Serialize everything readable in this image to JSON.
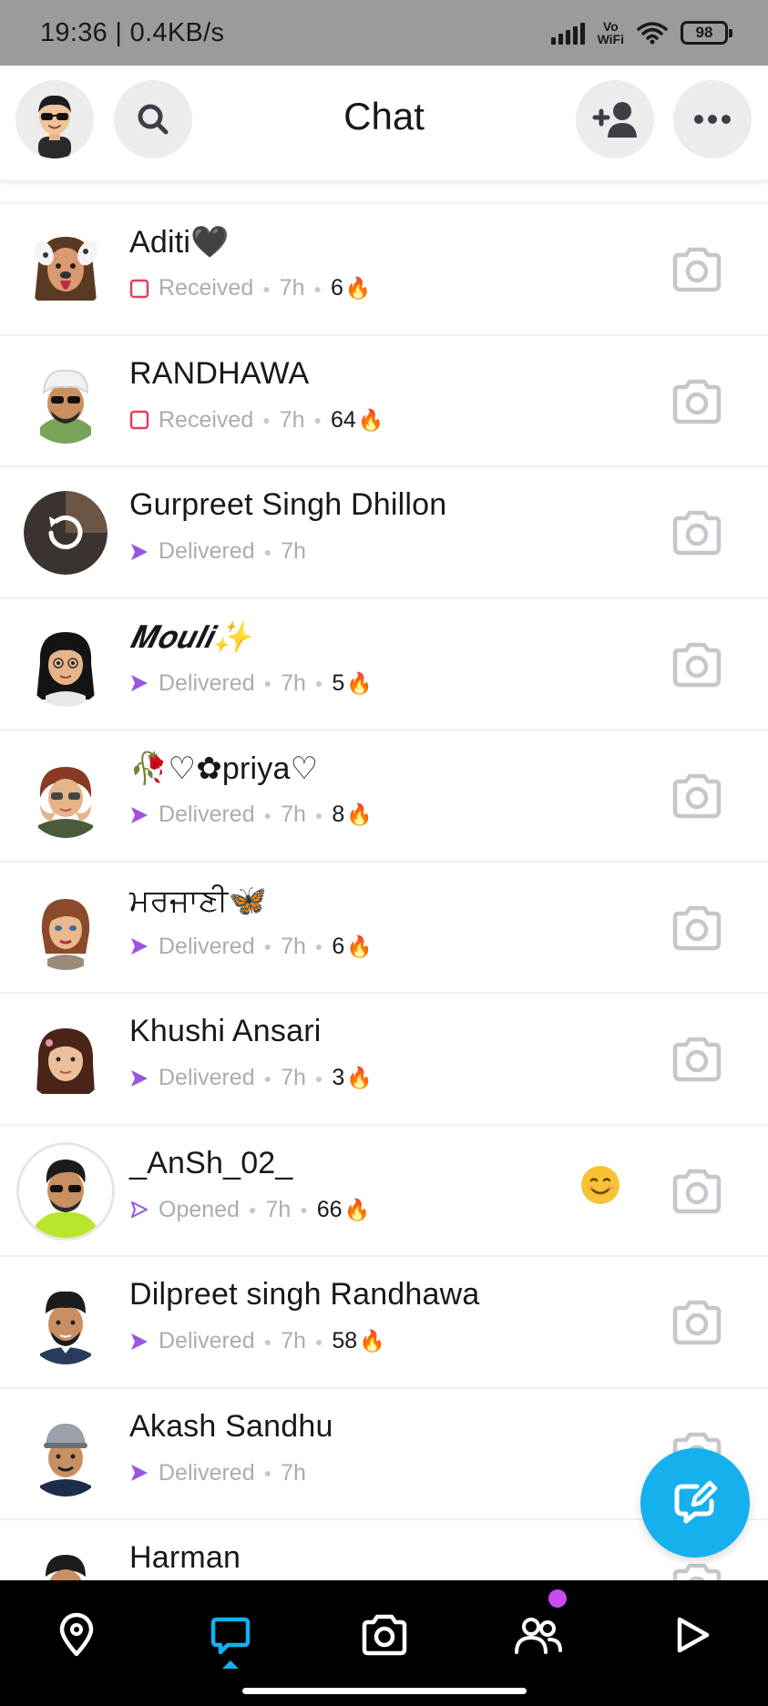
{
  "status_bar": {
    "time_speed": "19:36 | 0.4KB/s",
    "vowifi": "Vo WiFi",
    "battery": "98"
  },
  "header": {
    "title": "Chat",
    "icons": [
      "bitmoji-avatar",
      "search-icon",
      "add-friend-icon",
      "more-icon"
    ]
  },
  "chats": [
    {
      "name": "Aditi🖤",
      "status": "Received",
      "status_type": "received",
      "time": "7h",
      "streak": "6"
    },
    {
      "name": "RANDHAWA",
      "status": "Received",
      "status_type": "received",
      "time": "7h",
      "streak": "64"
    },
    {
      "name": "Gurpreet Singh Dhillon",
      "status": "Delivered",
      "status_type": "delivered",
      "time": "7h",
      "streak": ""
    },
    {
      "name": "𝑴𝒐𝒖𝒍𝒊✨",
      "status": "Delivered",
      "status_type": "delivered",
      "time": "7h",
      "streak": "5"
    },
    {
      "name": "🥀♡✿priya♡",
      "status": "Delivered",
      "status_type": "delivered",
      "time": "7h",
      "streak": "8"
    },
    {
      "name": "ਮਰਜਾਣੀ🦋",
      "status": "Delivered",
      "status_type": "delivered",
      "time": "7h",
      "streak": "6"
    },
    {
      "name": "Khushi Ansari",
      "status": "Delivered",
      "status_type": "delivered",
      "time": "7h",
      "streak": "3"
    },
    {
      "name": "_AnSh_02_",
      "status": "Opened",
      "status_type": "opened",
      "time": "7h",
      "streak": "66",
      "emoji": "smiling-face-emoji"
    },
    {
      "name": "Dilpreet singh Randhawa",
      "status": "Delivered",
      "status_type": "delivered",
      "time": "7h",
      "streak": "58"
    },
    {
      "name": "Akash Sandhu",
      "status": "Delivered",
      "status_type": "delivered",
      "time": "7h",
      "streak": ""
    },
    {
      "name": "Harman",
      "status": "",
      "status_type": "",
      "time": "",
      "streak": ""
    }
  ],
  "bottom_nav": [
    "map-pin-icon",
    "chat-icon",
    "camera-icon",
    "friends-icon",
    "stories-icon"
  ],
  "colors": {
    "accent": "#14b1ee",
    "received": "#e0405c",
    "delivered": "#9b55e0",
    "notification": "#c64cf2"
  }
}
